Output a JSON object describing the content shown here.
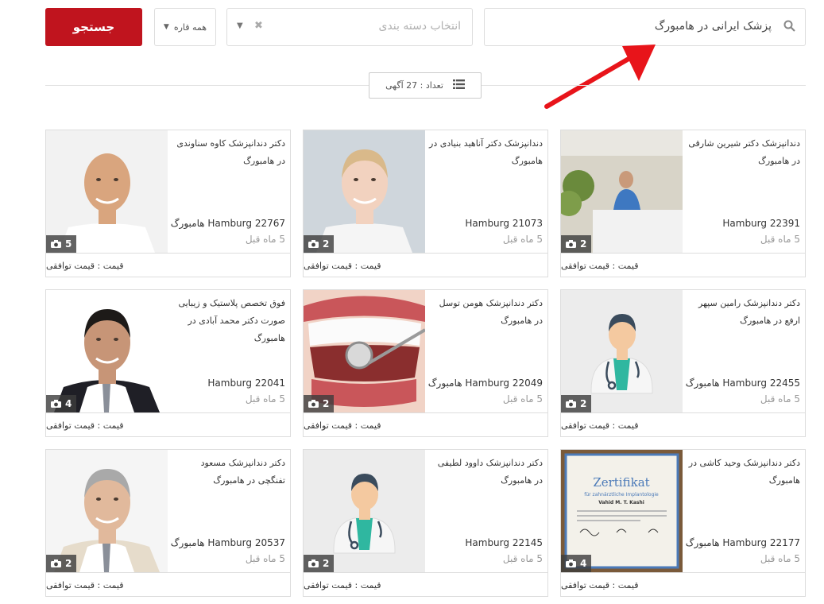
{
  "search": {
    "button_label": "جستجو",
    "region_value": "همه قاره",
    "category_placeholder": "انتخاب دسته بندی",
    "query": "پزشک ایرانی در هامبورگ"
  },
  "results": {
    "count_label": "تعداد : 27 آگهی"
  },
  "colors": {
    "accent": "#c0141e",
    "arrow": "#e8141a"
  },
  "icons": [
    "search-icon",
    "list-icon",
    "camera-icon",
    "chevron-down-icon",
    "clear-icon"
  ],
  "listings": [
    {
      "title": "دکتر دندانپزشک کاوه سناوندی در هامبورگ",
      "location": "Hamburg 22767 هامبورگ",
      "age": "5 ماه قبل",
      "price": "قیمت : قیمت توافقی",
      "photo_count": "5"
    },
    {
      "title": "دندانپزشک دکتر آناهید بنیادی در هامبورگ",
      "location": "Hamburg 21073",
      "age": "5 ماه قبل",
      "price": "قیمت : قیمت توافقی",
      "photo_count": "2"
    },
    {
      "title": "دندانپزشک دکتر شیرین شارقی در هامبورگ",
      "location": "Hamburg 22391",
      "age": "5 ماه قبل",
      "price": "قیمت : قیمت توافقی",
      "photo_count": "2"
    },
    {
      "title": "فوق تخصص پلاستیک و زیبایی صورت دکتر محمد آبادی در هامبورگ",
      "location": "Hamburg 22041",
      "age": "5 ماه قبل",
      "price": "قیمت : قیمت توافقی",
      "photo_count": "4"
    },
    {
      "title": "دکتر دندانپزشک هومن توسل در هامبورگ",
      "location": "Hamburg 22049 هامبورگ",
      "age": "5 ماه قبل",
      "price": "قیمت : قیمت توافقی",
      "photo_count": "2"
    },
    {
      "title": "دکتر دندانپزشک رامین سپهر ارفع در هامبورگ",
      "location": "Hamburg 22455 هامبورگ",
      "age": "5 ماه قبل",
      "price": "قیمت : قیمت توافقی",
      "photo_count": "2"
    },
    {
      "title": "دکتر دندانپزشک مسعود تفنگچی در هامبورگ",
      "location": "Hamburg 20537 هامبورگ",
      "age": "5 ماه قبل",
      "price": "قیمت : قیمت توافقی",
      "photo_count": "2"
    },
    {
      "title": "دکتر دندانپزشک داوود لطیفی در هامبورگ",
      "location": "Hamburg 22145",
      "age": "5 ماه قبل",
      "price": "قیمت : قیمت توافقی",
      "photo_count": "2"
    },
    {
      "title": "دکتر دندانپزشک وحید کاشی در هامبورگ",
      "location": "Hamburg 22177 هامبورگ",
      "age": "5 ماه قبل",
      "price": "قیمت : قیمت توافقی",
      "photo_count": "4"
    }
  ],
  "certificate": {
    "heading": "Zertifikat",
    "subheading": "für zahnärztliche Implantologie",
    "name": "Vahid M. T. Kashi"
  }
}
